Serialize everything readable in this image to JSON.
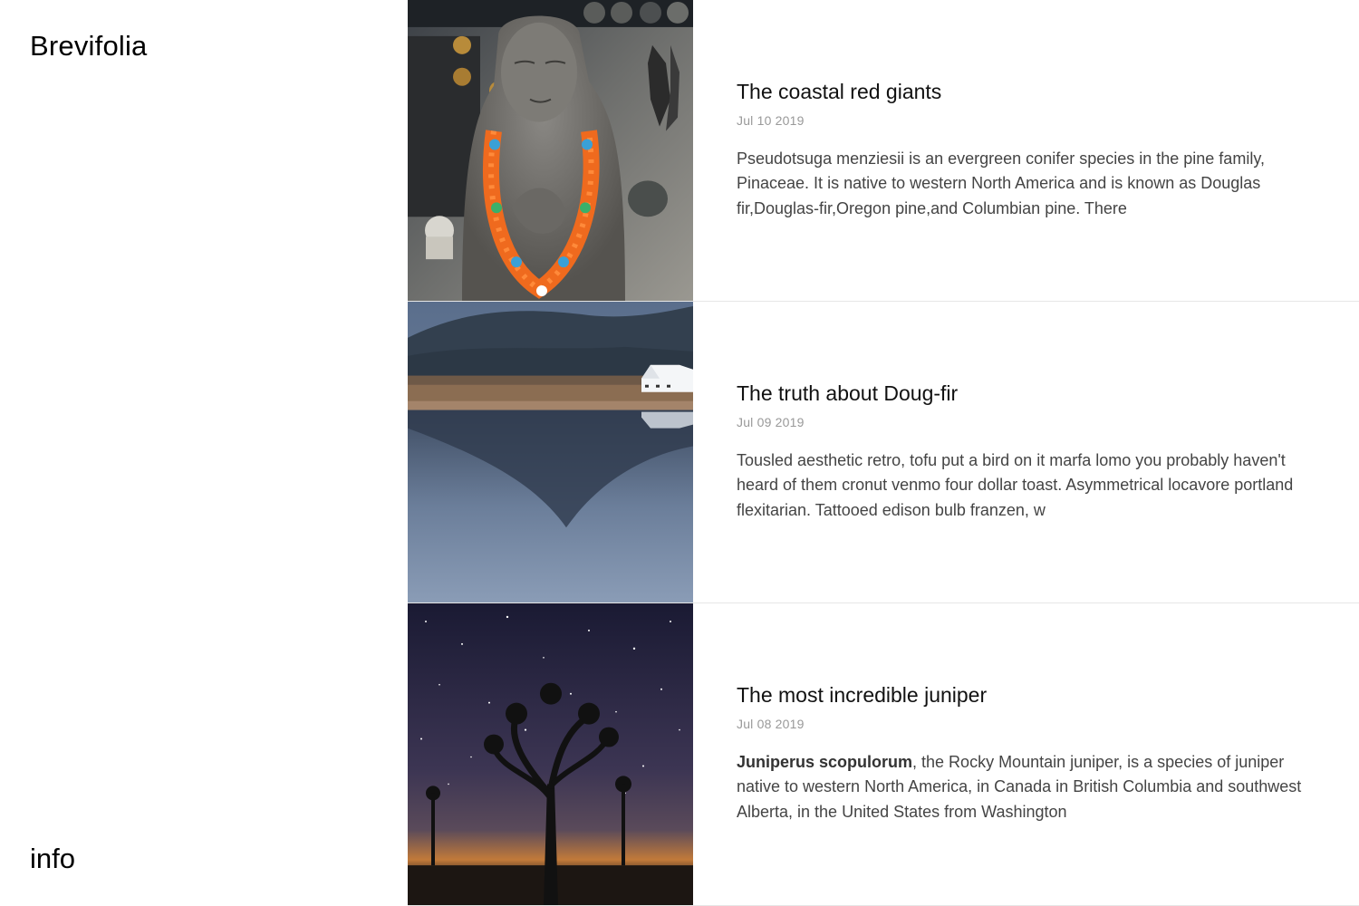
{
  "site": {
    "brand": "Brevifolia",
    "info_label": "info"
  },
  "posts": [
    {
      "title": "The coastal red giants",
      "date": "Jul 10 2019",
      "excerpt": "Pseudotsuga menziesii is an evergreen conifer species in the pine family, Pinaceae. It is native to western North America and is known as Douglas fir,Douglas-fir,Oregon pine,and Columbian pine. There",
      "image": "buddha-statue-with-orange-garland"
    },
    {
      "title": "The truth about Doug-fir",
      "date": "Jul 09 2019",
      "excerpt": "Tousled aesthetic retro, tofu put a bird on it marfa lomo you probably haven't heard of them cronut venmo four dollar toast. Asymmetrical locavore portland flexitarian. Tattooed edison bulb franzen, w",
      "image": "mountain-lake-reflection-with-white-building"
    },
    {
      "title": "The most incredible juniper",
      "date": "Jul 08 2019",
      "excerpt_bold": "Juniperus scopulorum",
      "excerpt": ", the Rocky Mountain juniper, is a species of juniper native to western North America, in Canada in British Columbia and southwest Alberta, in the United States from Washington",
      "image": "joshua-tree-under-starry-night-sky"
    }
  ]
}
